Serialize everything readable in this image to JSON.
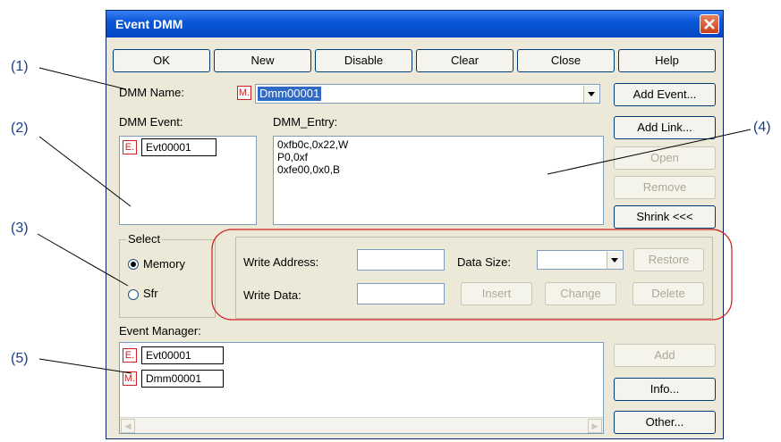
{
  "window": {
    "title": "Event DMM"
  },
  "top_buttons": [
    "OK",
    "New",
    "Disable",
    "Clear",
    "Close",
    "Help"
  ],
  "dmm_name": {
    "label": "DMM Name:",
    "marker": "M.",
    "value": "Dmm00001"
  },
  "dmm_event": {
    "label": "DMM Event:",
    "marker": "E.",
    "event_name": "Evt00001"
  },
  "dmm_entry": {
    "label": "DMM_Entry:",
    "lines": [
      "0xfb0c,0x22,W",
      "P0,0xf",
      "0xfe00,0x0,B"
    ]
  },
  "side_buttons": {
    "add_event": "Add Event...",
    "add_link": "Add Link...",
    "open": "Open",
    "remove": "Remove",
    "shrink": "Shrink <<<"
  },
  "select": {
    "label": "Select",
    "memory": "Memory",
    "sfr": "Sfr"
  },
  "write": {
    "address_label": "Write Address:",
    "data_label": "Write Data:",
    "data_size_label": "Data Size:",
    "restore": "Restore",
    "insert": "Insert",
    "change": "Change",
    "delete": "Delete"
  },
  "event_manager": {
    "label": "Event Manager:",
    "items": [
      {
        "marker": "E.",
        "name": "Evt00001"
      },
      {
        "marker": "M.",
        "name": "Dmm00001"
      }
    ],
    "add": "Add",
    "info": "Info...",
    "other": "Other..."
  },
  "callouts": [
    "(1)",
    "(2)",
    "(3)",
    "(4)",
    "(5)"
  ],
  "colors": {
    "title_bar": "#0a58d8",
    "highlight": "#d21e1e",
    "selection": "#316ac5"
  }
}
